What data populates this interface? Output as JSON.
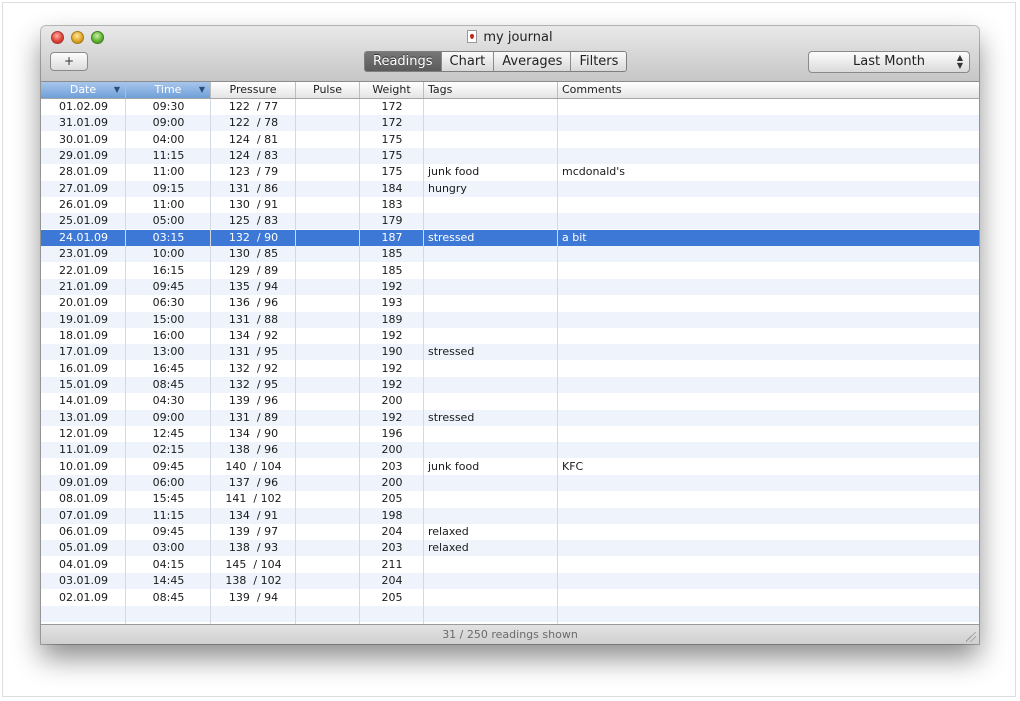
{
  "window": {
    "title": "my journal",
    "add_label": "+"
  },
  "toolbar": {
    "tabs": [
      {
        "label": "Readings",
        "active": true
      },
      {
        "label": "Chart",
        "active": false
      },
      {
        "label": "Averages",
        "active": false
      },
      {
        "label": "Filters",
        "active": false
      }
    ],
    "range_label": "Last Month",
    "range_arrows": "▲▼"
  },
  "table": {
    "columns": [
      "Date",
      "Time",
      "Pressure",
      "Pulse",
      "Weight",
      "Tags",
      "Comments"
    ],
    "sorted_columns": [
      "Date",
      "Time"
    ],
    "selected_row": 8,
    "rows": [
      {
        "date": "01.02.09",
        "time": "09:30",
        "pressure": "122  / 77",
        "pulse": "",
        "weight": "172",
        "tags": "",
        "comments": ""
      },
      {
        "date": "31.01.09",
        "time": "09:00",
        "pressure": "122  / 78",
        "pulse": "",
        "weight": "172",
        "tags": "",
        "comments": ""
      },
      {
        "date": "30.01.09",
        "time": "04:00",
        "pressure": "124  / 81",
        "pulse": "",
        "weight": "175",
        "tags": "",
        "comments": ""
      },
      {
        "date": "29.01.09",
        "time": "11:15",
        "pressure": "124  / 83",
        "pulse": "",
        "weight": "175",
        "tags": "",
        "comments": ""
      },
      {
        "date": "28.01.09",
        "time": "11:00",
        "pressure": "123  / 79",
        "pulse": "",
        "weight": "175",
        "tags": "junk food",
        "comments": "mcdonald's"
      },
      {
        "date": "27.01.09",
        "time": "09:15",
        "pressure": "131  / 86",
        "pulse": "",
        "weight": "184",
        "tags": "hungry",
        "comments": ""
      },
      {
        "date": "26.01.09",
        "time": "11:00",
        "pressure": "130  / 91",
        "pulse": "",
        "weight": "183",
        "tags": "",
        "comments": ""
      },
      {
        "date": "25.01.09",
        "time": "05:00",
        "pressure": "125  / 83",
        "pulse": "",
        "weight": "179",
        "tags": "",
        "comments": ""
      },
      {
        "date": "24.01.09",
        "time": "03:15",
        "pressure": "132  / 90",
        "pulse": "",
        "weight": "187",
        "tags": "stressed",
        "comments": "a bit"
      },
      {
        "date": "23.01.09",
        "time": "10:00",
        "pressure": "130  / 85",
        "pulse": "",
        "weight": "185",
        "tags": "",
        "comments": ""
      },
      {
        "date": "22.01.09",
        "time": "16:15",
        "pressure": "129  / 89",
        "pulse": "",
        "weight": "185",
        "tags": "",
        "comments": ""
      },
      {
        "date": "21.01.09",
        "time": "09:45",
        "pressure": "135  / 94",
        "pulse": "",
        "weight": "192",
        "tags": "",
        "comments": ""
      },
      {
        "date": "20.01.09",
        "time": "06:30",
        "pressure": "136  / 96",
        "pulse": "",
        "weight": "193",
        "tags": "",
        "comments": ""
      },
      {
        "date": "19.01.09",
        "time": "15:00",
        "pressure": "131  / 88",
        "pulse": "",
        "weight": "189",
        "tags": "",
        "comments": ""
      },
      {
        "date": "18.01.09",
        "time": "16:00",
        "pressure": "134  / 92",
        "pulse": "",
        "weight": "192",
        "tags": "",
        "comments": ""
      },
      {
        "date": "17.01.09",
        "time": "13:00",
        "pressure": "131  / 95",
        "pulse": "",
        "weight": "190",
        "tags": "stressed",
        "comments": ""
      },
      {
        "date": "16.01.09",
        "time": "16:45",
        "pressure": "132  / 92",
        "pulse": "",
        "weight": "192",
        "tags": "",
        "comments": ""
      },
      {
        "date": "15.01.09",
        "time": "08:45",
        "pressure": "132  / 95",
        "pulse": "",
        "weight": "192",
        "tags": "",
        "comments": ""
      },
      {
        "date": "14.01.09",
        "time": "04:30",
        "pressure": "139  / 96",
        "pulse": "",
        "weight": "200",
        "tags": "",
        "comments": ""
      },
      {
        "date": "13.01.09",
        "time": "09:00",
        "pressure": "131  / 89",
        "pulse": "",
        "weight": "192",
        "tags": "stressed",
        "comments": ""
      },
      {
        "date": "12.01.09",
        "time": "12:45",
        "pressure": "134  / 90",
        "pulse": "",
        "weight": "196",
        "tags": "",
        "comments": ""
      },
      {
        "date": "11.01.09",
        "time": "02:15",
        "pressure": "138  / 96",
        "pulse": "",
        "weight": "200",
        "tags": "",
        "comments": ""
      },
      {
        "date": "10.01.09",
        "time": "09:45",
        "pressure": "140  / 104",
        "pulse": "",
        "weight": "203",
        "tags": "junk food",
        "comments": "KFC"
      },
      {
        "date": "09.01.09",
        "time": "06:00",
        "pressure": "137  / 96",
        "pulse": "",
        "weight": "200",
        "tags": "",
        "comments": ""
      },
      {
        "date": "08.01.09",
        "time": "15:45",
        "pressure": "141  / 102",
        "pulse": "",
        "weight": "205",
        "tags": "",
        "comments": ""
      },
      {
        "date": "07.01.09",
        "time": "11:15",
        "pressure": "134  / 91",
        "pulse": "",
        "weight": "198",
        "tags": "",
        "comments": ""
      },
      {
        "date": "06.01.09",
        "time": "09:45",
        "pressure": "139  / 97",
        "pulse": "",
        "weight": "204",
        "tags": "relaxed",
        "comments": ""
      },
      {
        "date": "05.01.09",
        "time": "03:00",
        "pressure": "138  / 93",
        "pulse": "",
        "weight": "203",
        "tags": "relaxed",
        "comments": ""
      },
      {
        "date": "04.01.09",
        "time": "04:15",
        "pressure": "145  / 104",
        "pulse": "",
        "weight": "211",
        "tags": "",
        "comments": ""
      },
      {
        "date": "03.01.09",
        "time": "14:45",
        "pressure": "138  / 102",
        "pulse": "",
        "weight": "204",
        "tags": "",
        "comments": ""
      },
      {
        "date": "02.01.09",
        "time": "08:45",
        "pressure": "139  / 94",
        "pulse": "",
        "weight": "205",
        "tags": "",
        "comments": ""
      }
    ]
  },
  "status": {
    "text": "31 / 250 readings shown"
  }
}
